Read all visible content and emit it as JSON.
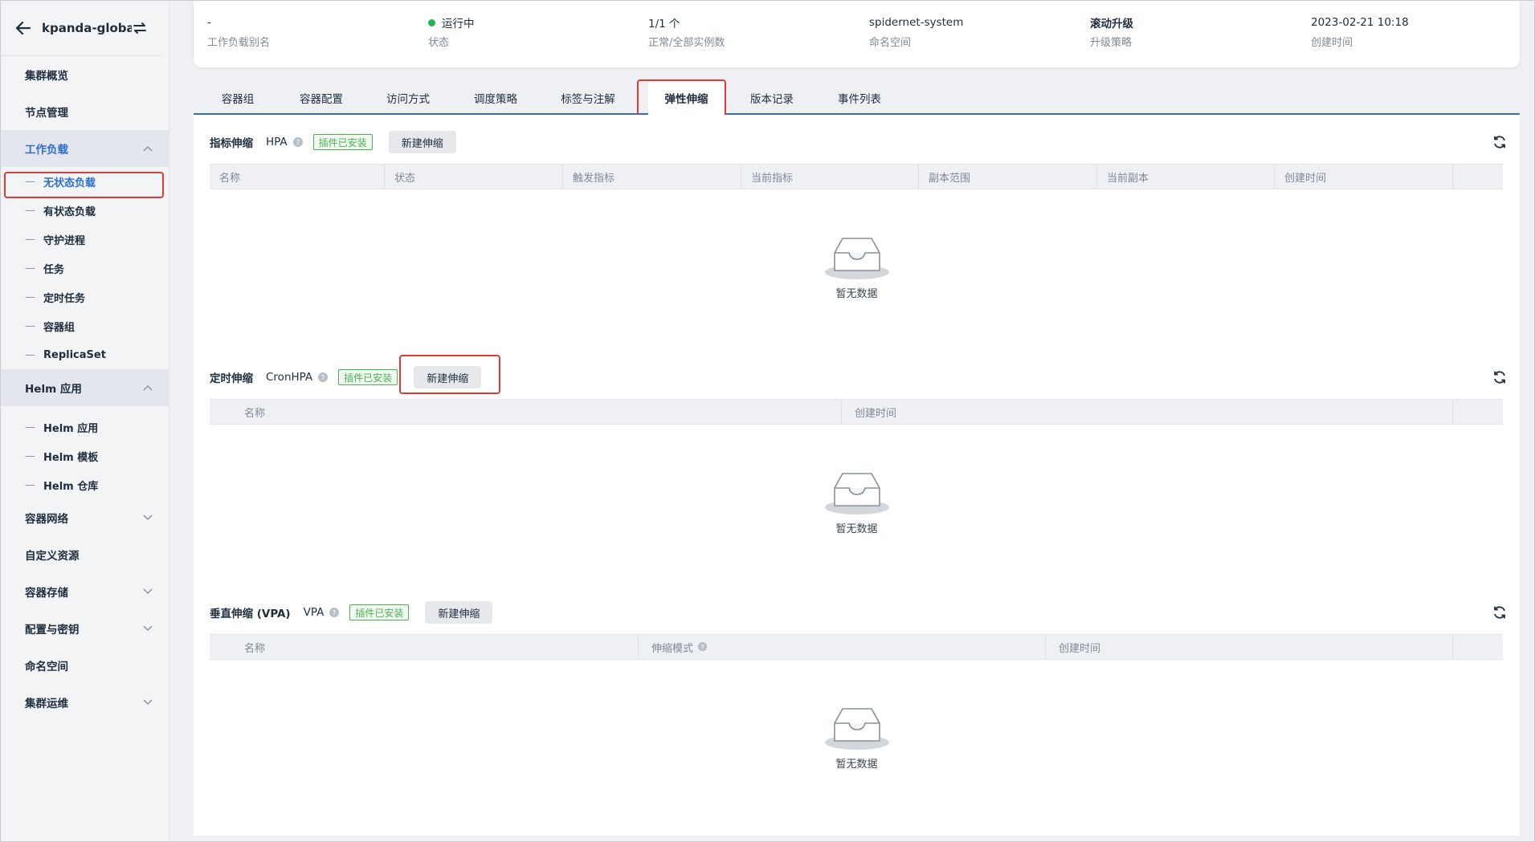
{
  "sidebar": {
    "title": "kpanda-global-...",
    "items": [
      {
        "label": "集群概览"
      },
      {
        "label": "节点管理"
      },
      {
        "label": "工作负载"
      },
      {
        "label": "无状态负载"
      },
      {
        "label": "有状态负载"
      },
      {
        "label": "守护进程"
      },
      {
        "label": "任务"
      },
      {
        "label": "定时任务"
      },
      {
        "label": "容器组"
      },
      {
        "label": "ReplicaSet"
      },
      {
        "label": "Helm 应用"
      },
      {
        "label": "Helm 应用"
      },
      {
        "label": "Helm 模板"
      },
      {
        "label": "Helm 仓库"
      },
      {
        "label": "容器网络"
      },
      {
        "label": "自定义资源"
      },
      {
        "label": "容器存储"
      },
      {
        "label": "配置与密钥"
      },
      {
        "label": "命名空间"
      },
      {
        "label": "集群运维"
      }
    ]
  },
  "info": {
    "alias_value": "-",
    "alias_label": "工作负载别名",
    "status_value": "运行中",
    "status_label": "状态",
    "replicas_value": "1/1 个",
    "replicas_label": "正常/全部实例数",
    "namespace_value": "spidernet-system",
    "namespace_label": "命名空间",
    "strategy_value": "滚动升级",
    "strategy_label": "升级策略",
    "created_value": "2023-02-21 10:18",
    "created_label": "创建时间"
  },
  "tabs": [
    "容器组",
    "容器配置",
    "访问方式",
    "调度策略",
    "标签与注解",
    "弹性伸缩",
    "版本记录",
    "事件列表"
  ],
  "hpa": {
    "title": "指标伸缩",
    "kind": "HPA",
    "tag": "插件已安装",
    "button": "新建伸缩",
    "columns": [
      "名称",
      "状态",
      "触发指标",
      "当前指标",
      "副本范围",
      "当前副本",
      "创建时间"
    ],
    "empty": "暂无数据"
  },
  "cronhpa": {
    "title": "定时伸缩",
    "kind": "CronHPA",
    "tag": "插件已安装",
    "button": "新建伸缩",
    "columns": [
      "名称",
      "创建时间"
    ],
    "empty": "暂无数据"
  },
  "vpa": {
    "title": "垂直伸缩 (VPA)",
    "kind": "VPA",
    "tag": "插件已安装",
    "button": "新建伸缩",
    "columns": [
      "名称",
      "伸缩模式",
      "创建时间"
    ],
    "empty": "暂无数据"
  },
  "colors": {
    "accent": "#2d6fd0",
    "success": "#22b356",
    "highlight": "#e53935"
  }
}
